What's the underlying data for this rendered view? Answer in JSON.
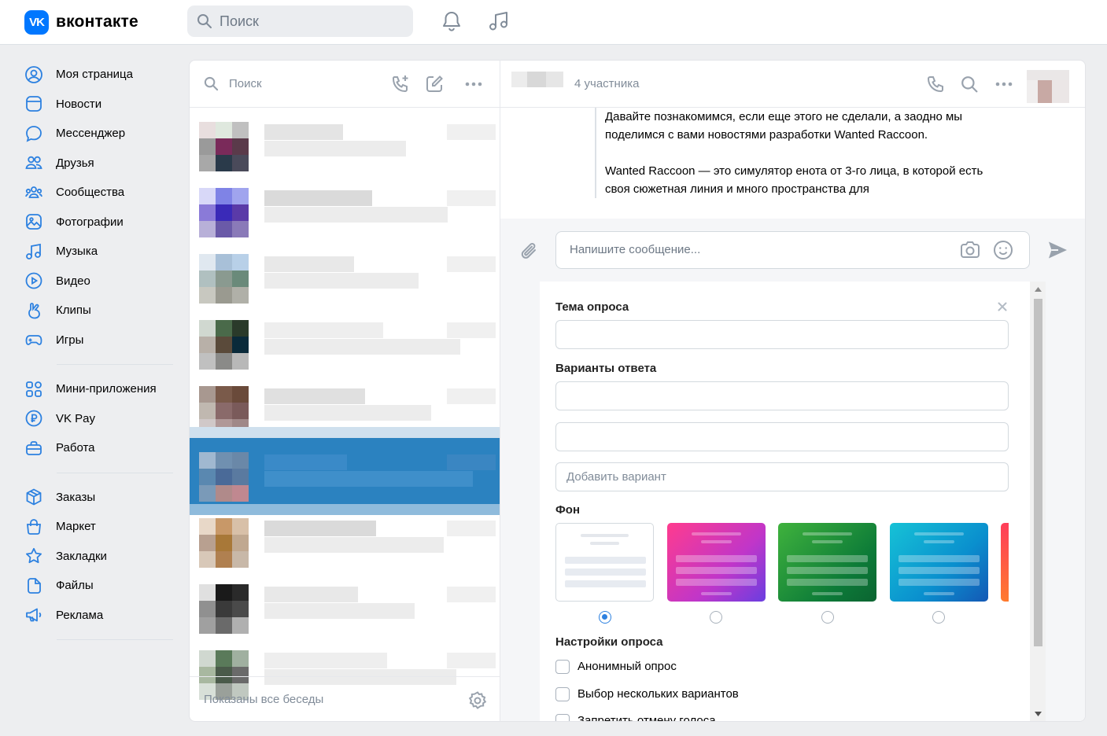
{
  "header": {
    "logo_mark": "VK",
    "logo_text": "вконтакте",
    "search_placeholder": "Поиск",
    "icons": [
      "search-icon",
      "bell-icon",
      "music-icon"
    ]
  },
  "sidebar": {
    "group1": [
      {
        "label": "Моя страница",
        "icon": "user-circle-icon"
      },
      {
        "label": "Новости",
        "icon": "newsfeed-icon"
      },
      {
        "label": "Мессенджер",
        "icon": "message-icon"
      },
      {
        "label": "Друзья",
        "icon": "friends-icon"
      },
      {
        "label": "Сообщества",
        "icon": "communities-icon"
      },
      {
        "label": "Фотографии",
        "icon": "photo-icon"
      },
      {
        "label": "Музыка",
        "icon": "music-icon"
      },
      {
        "label": "Видео",
        "icon": "video-icon"
      },
      {
        "label": "Клипы",
        "icon": "clips-icon"
      },
      {
        "label": "Игры",
        "icon": "gamepad-icon"
      }
    ],
    "group2": [
      {
        "label": "Мини-приложения",
        "icon": "apps-icon"
      },
      {
        "label": "VK Pay",
        "icon": "ruble-icon"
      },
      {
        "label": "Работа",
        "icon": "briefcase-icon"
      }
    ],
    "group3": [
      {
        "label": "Заказы",
        "icon": "box-icon"
      },
      {
        "label": "Маркет",
        "icon": "bag-icon"
      },
      {
        "label": "Закладки",
        "icon": "star-icon"
      },
      {
        "label": "Файлы",
        "icon": "file-icon"
      },
      {
        "label": "Реклама",
        "icon": "megaphone-icon"
      }
    ]
  },
  "conversations": {
    "search_placeholder": "Поиск",
    "footer_text": "Показаны все беседы",
    "icons": [
      "search-icon",
      "add-call-icon",
      "compose-icon",
      "more-icon",
      "settings-icon"
    ],
    "selected_index": 5,
    "count": 9
  },
  "chat": {
    "participants": "4 участника",
    "icons": [
      "phone-icon",
      "search-icon",
      "more-icon"
    ],
    "message_p1": "Давайте познакомимся, если еще этого не сделали, а заодно мы поделимся с вами новостями разработки Wanted Raccoon.",
    "message_p2": "Wanted Raccoon — это симулятор енота от 3-го лица, в которой есть своя сюжетная линия и много пространства для",
    "input_placeholder": "Напишите сообщение...",
    "input_icons": [
      "attach-icon",
      "camera-icon",
      "smile-icon",
      "send-icon"
    ]
  },
  "poll": {
    "topic_label": "Тема опроса",
    "topic_value": "",
    "answers_label": "Варианты ответа",
    "answers": [
      "",
      ""
    ],
    "add_option_placeholder": "Добавить вариант",
    "background_label": "Фон",
    "backgrounds": [
      "white",
      "pink-purple-gradient",
      "green-gradient",
      "teal-blue-gradient",
      "orange-red-gradient"
    ],
    "selected_background": 0,
    "settings_label": "Настройки опроса",
    "options": [
      {
        "label": "Анонимный опрос",
        "checked": false
      },
      {
        "label": "Выбор нескольких вариантов",
        "checked": false
      },
      {
        "label": "Запретить отмену голоса",
        "checked": false
      }
    ]
  },
  "colors": {
    "accent": "#2d81e0",
    "vk_blue": "#0077ff",
    "selected_row": "#2b82c0"
  }
}
